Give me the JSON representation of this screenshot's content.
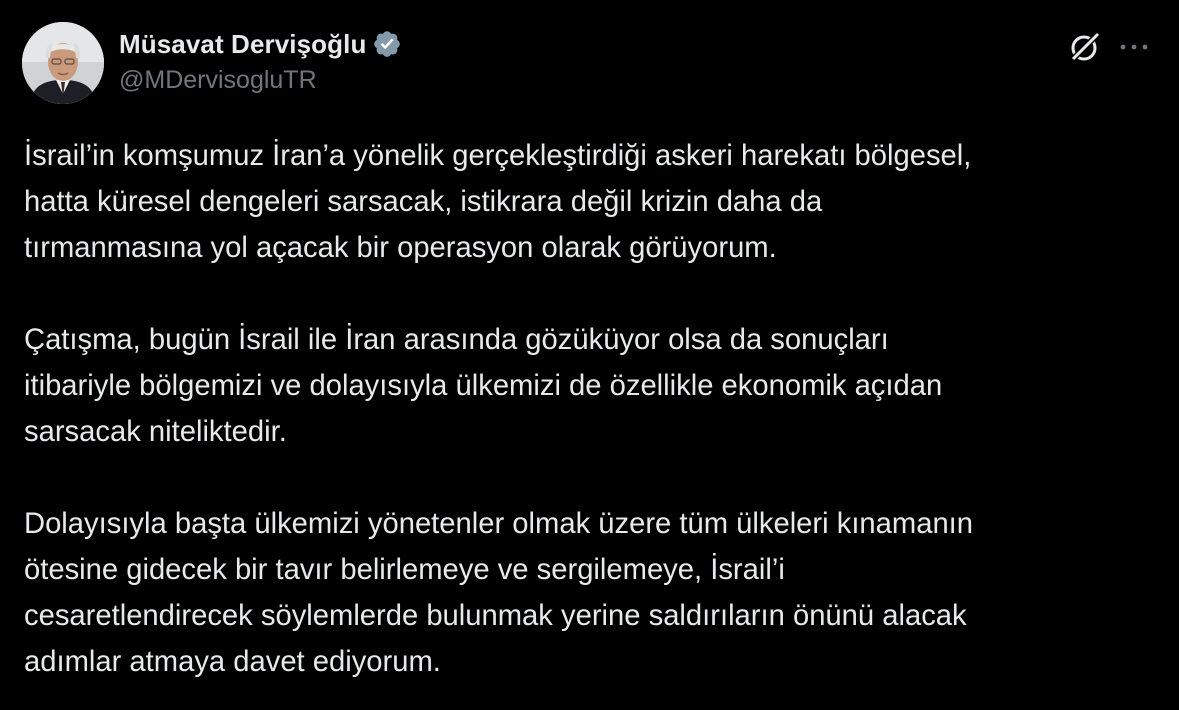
{
  "author": {
    "display_name": "Müsavat Dervişoğlu",
    "handle": "@MDervisogluTR",
    "verified": true,
    "avatar_icon": "profile-photo"
  },
  "actions": {
    "grok_icon": "grok-icon",
    "more_icon": "more-horizontal-icon"
  },
  "colors": {
    "background": "#000000",
    "text": "#e7e9ea",
    "secondary": "#71767b",
    "verified_badge": "#829aab"
  },
  "tweet": {
    "paragraphs": [
      {
        "lines": [
          "İsrail’in komşumuz İran’a yönelik gerçekleştirdiği askeri harekatı bölgesel,",
          "hatta küresel dengeleri sarsacak, istikrara değil krizin daha da",
          "tırmanmasına yol açacak bir operasyon olarak görüyorum."
        ]
      },
      {
        "lines": [
          "Çatışma, bugün İsrail ile İran arasında gözüküyor olsa da sonuçları",
          "itibariyle bölgemizi ve dolayısıyla ülkemizi de özellikle ekonomik açıdan",
          "sarsacak niteliktedir."
        ]
      },
      {
        "lines": [
          "Dolayısıyla başta ülkemizi yönetenler olmak üzere tüm ülkeleri kınamanın",
          "ötesine gidecek bir tavır belirlemeye ve sergilemeye, İsrail’i",
          "cesaretlendirecek söylemlerde bulunmak yerine saldırıların önünü alacak",
          "adımlar atmaya davet ediyorum."
        ]
      }
    ]
  }
}
